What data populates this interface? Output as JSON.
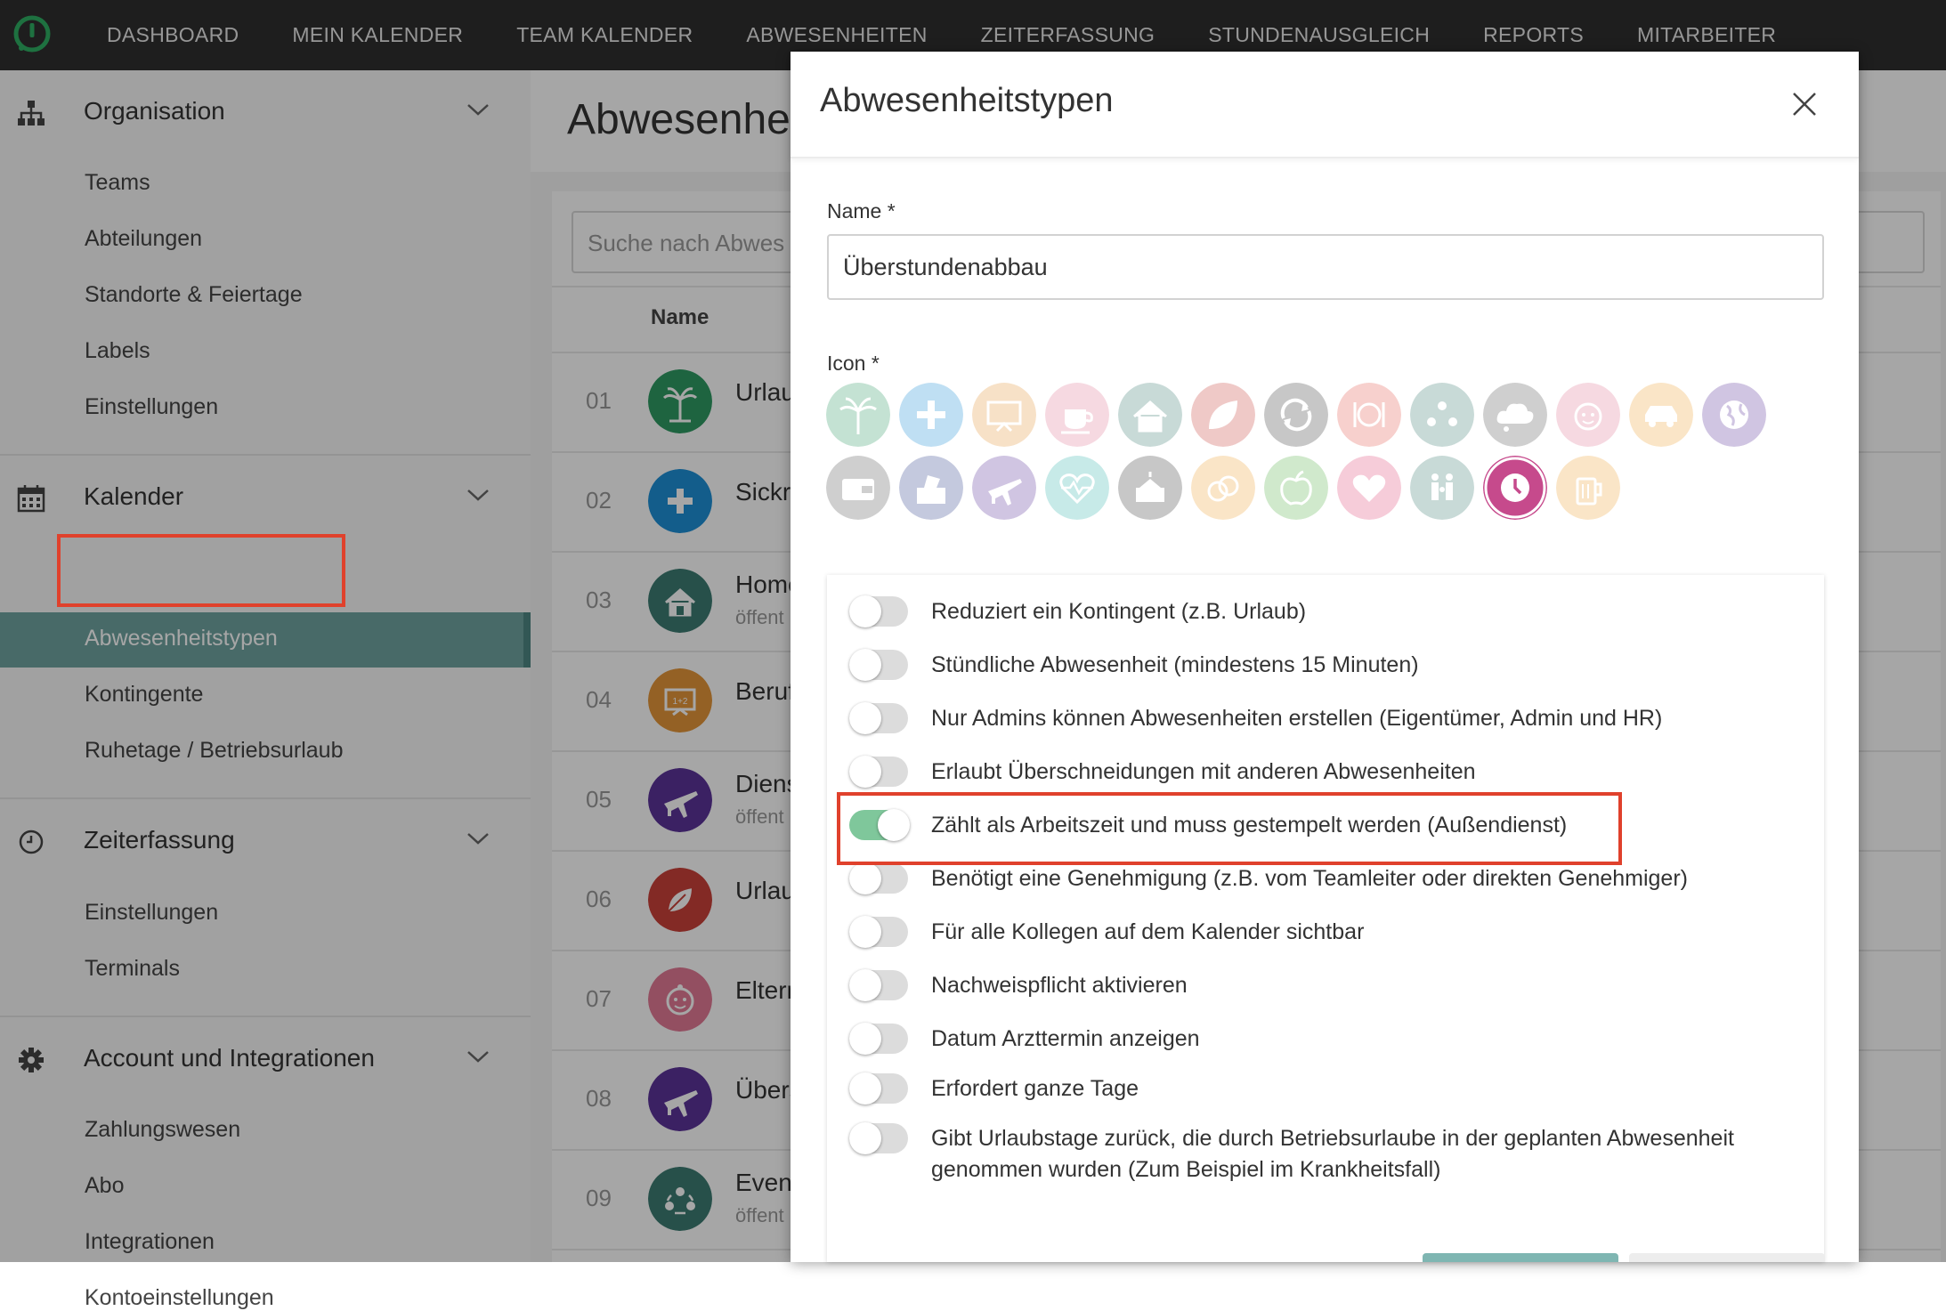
{
  "topnav": [
    "DASHBOARD",
    "MEIN KALENDER",
    "TEAM KALENDER",
    "ABWESENHEITEN",
    "ZEITERFASSUNG",
    "STUNDENAUSGLEICH",
    "REPORTS",
    "MITARBEITER"
  ],
  "sidebar": {
    "organisation": {
      "title": "Organisation",
      "items": [
        "Teams",
        "Abteilungen",
        "Standorte & Feiertage",
        "Labels",
        "Einstellungen"
      ]
    },
    "kalender": {
      "title": "Kalender",
      "items": [
        "Abwesenheitstypen",
        "Kontingente",
        "Ruhetage / Betriebsurlaub"
      ],
      "active": "Abwesenheitstypen"
    },
    "zeiterfassung": {
      "title": "Zeiterfassung",
      "items": [
        "Einstellungen",
        "Terminals"
      ]
    },
    "account": {
      "title": "Account und Integrationen",
      "items": [
        "Zahlungswesen",
        "Abo",
        "Integrationen",
        "Kontoeinstellungen"
      ]
    }
  },
  "main": {
    "title": "Abwesenhe",
    "search_placeholder": "Suche nach Abwes",
    "col_name": "Name",
    "rows": [
      {
        "num": "01",
        "name": "Urlau",
        "sub": "",
        "color": "#2e9a63"
      },
      {
        "num": "02",
        "name": "Sickr",
        "sub": "",
        "color": "#1e8fd6"
      },
      {
        "num": "03",
        "name": "Home",
        "sub": "öffent",
        "color": "#3d7c72"
      },
      {
        "num": "04",
        "name": "Beruf",
        "sub": "",
        "color": "#e3953a"
      },
      {
        "num": "05",
        "name": "Diens",
        "sub": "öffent",
        "color": "#5b3399"
      },
      {
        "num": "06",
        "name": "Urlau",
        "sub": "",
        "color": "#c9413a"
      },
      {
        "num": "07",
        "name": "Elterr",
        "sub": "",
        "color": "#e27a95"
      },
      {
        "num": "08",
        "name": "Übers",
        "sub": "",
        "color": "#5b3399"
      },
      {
        "num": "09",
        "name": "Even",
        "sub": "öffent",
        "color": "#3d7c72"
      }
    ]
  },
  "modal": {
    "title": "Abwesenheitstypen",
    "name_label": "Name *",
    "name_value": "Überstundenabbau",
    "icon_label": "Icon *",
    "icons": [
      {
        "name": "palm-tree-icon",
        "color": "#2e9a63"
      },
      {
        "name": "plus-icon",
        "color": "#1e8fd6"
      },
      {
        "name": "whiteboard-icon",
        "color": "#e3953a"
      },
      {
        "name": "coffee-cup-icon",
        "color": "#e27a95"
      },
      {
        "name": "home-icon",
        "color": "#3d7c72"
      },
      {
        "name": "leaf-icon",
        "color": "#c9413a"
      },
      {
        "name": "sync-arrows-icon",
        "color": "#3a3a3a"
      },
      {
        "name": "plate-icon",
        "color": "#e35a4e"
      },
      {
        "name": "group-icon",
        "color": "#3d7c72"
      },
      {
        "name": "cloud-icon",
        "color": "#555555"
      },
      {
        "name": "baby-icon",
        "color": "#e27a95"
      },
      {
        "name": "car-icon",
        "color": "#f0a53a"
      },
      {
        "name": "globe-icon",
        "color": "#5b3399"
      },
      {
        "name": "wallet-icon",
        "color": "#555555"
      },
      {
        "name": "ballot-box-icon",
        "color": "#2f3f8a"
      },
      {
        "name": "plane-icon",
        "color": "#5b3399"
      },
      {
        "name": "heartbeat-icon",
        "color": "#3bb7b0"
      },
      {
        "name": "cake-icon",
        "color": "#3a3a3a"
      },
      {
        "name": "rings-icon",
        "color": "#f0a53a"
      },
      {
        "name": "apple-icon",
        "color": "#5ab24a"
      },
      {
        "name": "heart-icon",
        "color": "#e24a78"
      },
      {
        "name": "family-icon",
        "color": "#3d7c72"
      },
      {
        "name": "clock-icon",
        "color": "#c64a8c"
      },
      {
        "name": "beer-icon",
        "color": "#f0a53a"
      }
    ],
    "selected_icon": "clock-icon",
    "options": [
      {
        "label": "Reduziert ein Kontingent (z.B. Urlaub)",
        "on": false
      },
      {
        "label": "Stündliche Abwesenheit (mindestens 15 Minuten)",
        "on": false
      },
      {
        "label": "Nur Admins können Abwesenheiten erstellen (Eigentümer, Admin und HR)",
        "on": false
      },
      {
        "label": "Erlaubt Überschneidungen mit anderen Abwesenheiten",
        "on": false
      },
      {
        "label": "Zählt als Arbeitszeit und muss gestempelt werden (Außendienst)",
        "on": true
      },
      {
        "label": "Benötigt eine Genehmigung (z.B. vom Teamleiter oder direkten Genehmiger)",
        "on": false
      },
      {
        "label": "Für alle Kollegen auf dem Kalender sichtbar",
        "on": false
      },
      {
        "label": "Nachweispflicht aktivieren",
        "on": false
      },
      {
        "label": "Datum Arzttermin anzeigen",
        "on": false
      },
      {
        "label": "Erfordert ganze Tage",
        "on": false
      },
      {
        "label": "Gibt Urlaubstage zurück, die durch Betriebsurlaube in der geplanten Abwesenheit genommen wurden (Zum Beispiel im Krankheitsfall)",
        "on": false
      }
    ]
  },
  "colors": {
    "topbar": "#2e2e2e",
    "active_nav": "#6fa3a0",
    "toggle_on": "#7fc79b",
    "highlight": "#e0412c",
    "brand_green": "#2fae63"
  }
}
